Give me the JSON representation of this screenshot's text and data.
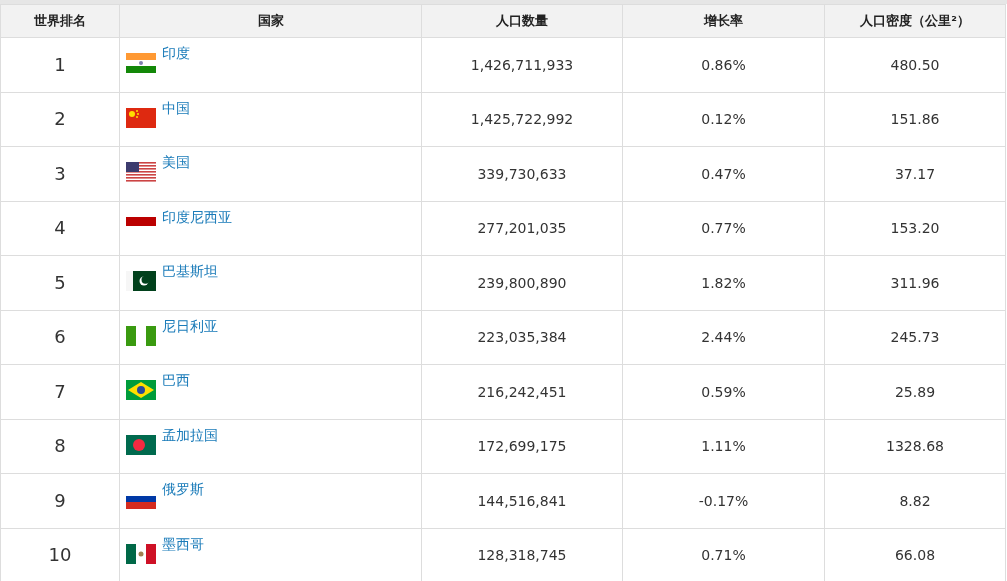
{
  "table": {
    "columns": [
      "世界排名",
      "国家",
      "人口数量",
      "增长率",
      "人口密度（公里²）"
    ],
    "rows": [
      {
        "rank": "1",
        "country": "印度",
        "kind": "india",
        "population": "1,426,711,933",
        "growth": "0.86%",
        "density": "480.50"
      },
      {
        "rank": "2",
        "country": "中国",
        "kind": "china",
        "population": "1,425,722,992",
        "growth": "0.12%",
        "density": "151.86"
      },
      {
        "rank": "3",
        "country": "美国",
        "kind": "usa",
        "population": "339,730,633",
        "growth": "0.47%",
        "density": "37.17"
      },
      {
        "rank": "4",
        "country": "印度尼西亚",
        "kind": "indonesia",
        "population": "277,201,035",
        "growth": "0.77%",
        "density": "153.20"
      },
      {
        "rank": "5",
        "country": "巴基斯坦",
        "kind": "pakistan",
        "population": "239,800,890",
        "growth": "1.82%",
        "density": "311.96"
      },
      {
        "rank": "6",
        "country": "尼日利亚",
        "kind": "nigeria",
        "population": "223,035,384",
        "growth": "2.44%",
        "density": "245.73"
      },
      {
        "rank": "7",
        "country": "巴西",
        "kind": "brazil",
        "population": "216,242,451",
        "growth": "0.59%",
        "density": "25.89"
      },
      {
        "rank": "8",
        "country": "孟加拉国",
        "kind": "bangladesh",
        "population": "172,699,175",
        "growth": "1.11%",
        "density": "1328.68"
      },
      {
        "rank": "9",
        "country": "俄罗斯",
        "kind": "russia",
        "population": "144,516,841",
        "growth": "-0.17%",
        "density": "8.82"
      },
      {
        "rank": "10",
        "country": "墨西哥",
        "kind": "mexico",
        "population": "128,318,745",
        "growth": "0.71%",
        "density": "66.08"
      }
    ]
  }
}
